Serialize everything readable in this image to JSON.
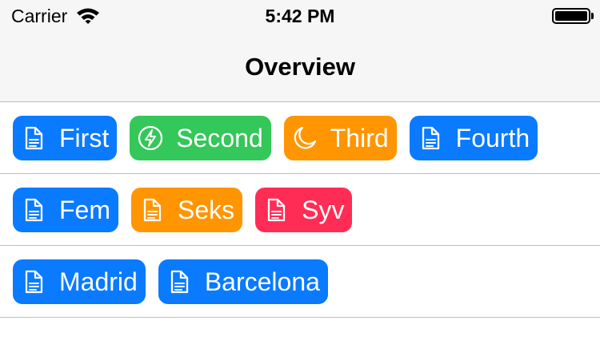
{
  "status_bar": {
    "carrier": "Carrier",
    "time": "5:42 PM",
    "wifi_icon": "wifi-icon",
    "battery_icon": "battery-icon"
  },
  "nav": {
    "title": "Overview"
  },
  "colors": {
    "blue": "#0a7aff",
    "green": "#34c759",
    "orange": "#ff9500",
    "pink": "#ff2d55"
  },
  "rows": [
    {
      "chips": [
        {
          "label": "First",
          "icon": "document-icon",
          "color": "blue"
        },
        {
          "label": "Second",
          "icon": "bolt-circle-icon",
          "color": "green"
        },
        {
          "label": "Third",
          "icon": "moon-icon",
          "color": "orange"
        },
        {
          "label": "Fourth",
          "icon": "document-icon",
          "color": "blue"
        }
      ]
    },
    {
      "chips": [
        {
          "label": "Fem",
          "icon": "document-icon",
          "color": "blue"
        },
        {
          "label": "Seks",
          "icon": "document-icon",
          "color": "orange"
        },
        {
          "label": "Syv",
          "icon": "document-icon",
          "color": "pink"
        }
      ]
    },
    {
      "chips": [
        {
          "label": "Madrid",
          "icon": "document-icon",
          "color": "blue"
        },
        {
          "label": "Barcelona",
          "icon": "document-icon",
          "color": "blue"
        }
      ]
    }
  ]
}
